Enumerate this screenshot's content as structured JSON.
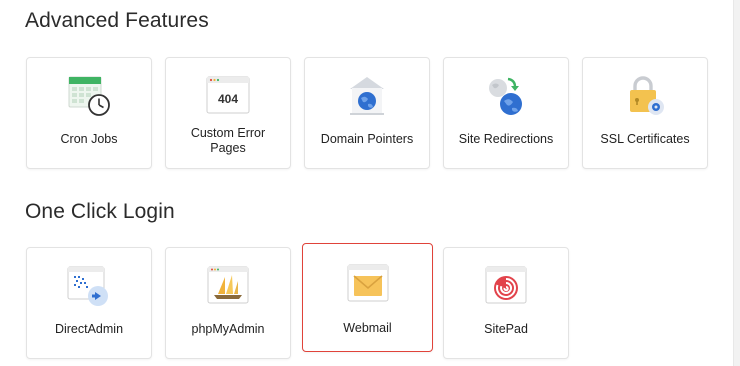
{
  "advanced": {
    "title": "Advanced Features",
    "items": [
      {
        "label": "Cron Jobs",
        "icon": "calendar-clock-icon"
      },
      {
        "label": "Custom Error Pages",
        "icon": "error-404-page-icon"
      },
      {
        "label": "Domain Pointers",
        "icon": "globe-house-icon"
      },
      {
        "label": "Site Redirections",
        "icon": "globe-redirect-icon"
      },
      {
        "label": "SSL Certificates",
        "icon": "padlock-gear-icon"
      }
    ]
  },
  "login": {
    "title": "One Click Login",
    "items": [
      {
        "label": "DirectAdmin",
        "icon": "directadmin-login-icon"
      },
      {
        "label": "phpMyAdmin",
        "icon": "phpmyadmin-sailboat-icon"
      },
      {
        "label": "Webmail",
        "icon": "envelope-icon"
      },
      {
        "label": "SitePad",
        "icon": "sitepad-logo-icon"
      }
    ]
  },
  "icon_texts": {
    "error_code": "404"
  },
  "colors": {
    "selected_border": "#e0433a",
    "globe_blue": "#2f6fd0",
    "calendar_green": "#3fb463",
    "lock_yellow": "#f3c24f",
    "envelope_yellow": "#f6c35a",
    "sitepad_red": "#e2434b",
    "redirect_arrow_green": "#3fb463"
  }
}
